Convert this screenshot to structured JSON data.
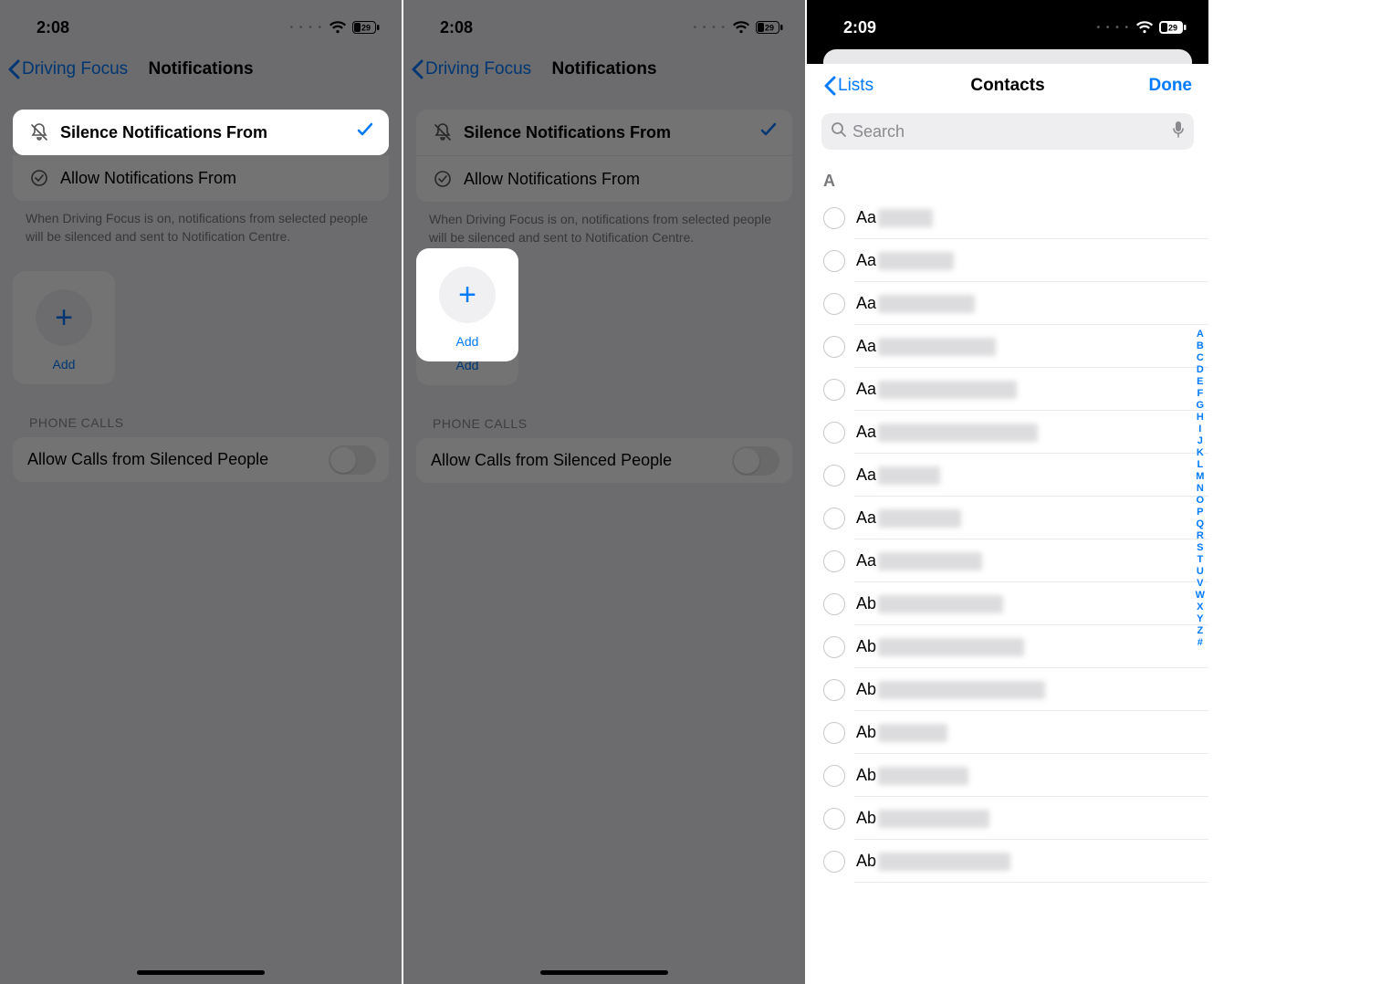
{
  "panel1": {
    "status": {
      "time": "2:08",
      "batt": "29"
    },
    "nav": {
      "back": "Driving Focus",
      "title": "Notifications"
    },
    "options": {
      "silence": "Silence Notifications From",
      "allow": "Allow Notifications From"
    },
    "footer": "When Driving Focus is on, notifications from selected people will be silenced and sent to Notification Centre.",
    "add": "Add",
    "phone_header": "PHONE CALLS",
    "allow_calls": "Allow Calls from Silenced People"
  },
  "panel2": {
    "status": {
      "time": "2:08",
      "batt": "29"
    },
    "nav": {
      "back": "Driving Focus",
      "title": "Notifications"
    },
    "options": {
      "silence": "Silence Notifications From",
      "allow": "Allow Notifications From"
    },
    "footer": "When Driving Focus is on, notifications from selected people will be silenced and sent to Notification Centre.",
    "add": "Add",
    "phone_header": "PHONE CALLS",
    "allow_calls": "Allow Calls from Silenced People"
  },
  "panel3": {
    "status": {
      "time": "2:09",
      "batt": "29"
    },
    "nav": {
      "back": "Lists",
      "title": "Contacts",
      "done": "Done"
    },
    "search_placeholder": "Search",
    "section": "A",
    "contacts": [
      "Aa",
      "Aa",
      "Aa",
      "Aa",
      "Aa",
      "Aa",
      "Aa",
      "Aa",
      "Aa",
      "Ab",
      "Ab",
      "Ab",
      "Ab",
      "Ab",
      "Ab",
      "Ab"
    ],
    "alpha": [
      "A",
      "B",
      "C",
      "D",
      "E",
      "F",
      "G",
      "H",
      "I",
      "J",
      "K",
      "L",
      "M",
      "N",
      "O",
      "P",
      "Q",
      "R",
      "S",
      "T",
      "U",
      "V",
      "W",
      "X",
      "Y",
      "Z",
      "#"
    ]
  }
}
